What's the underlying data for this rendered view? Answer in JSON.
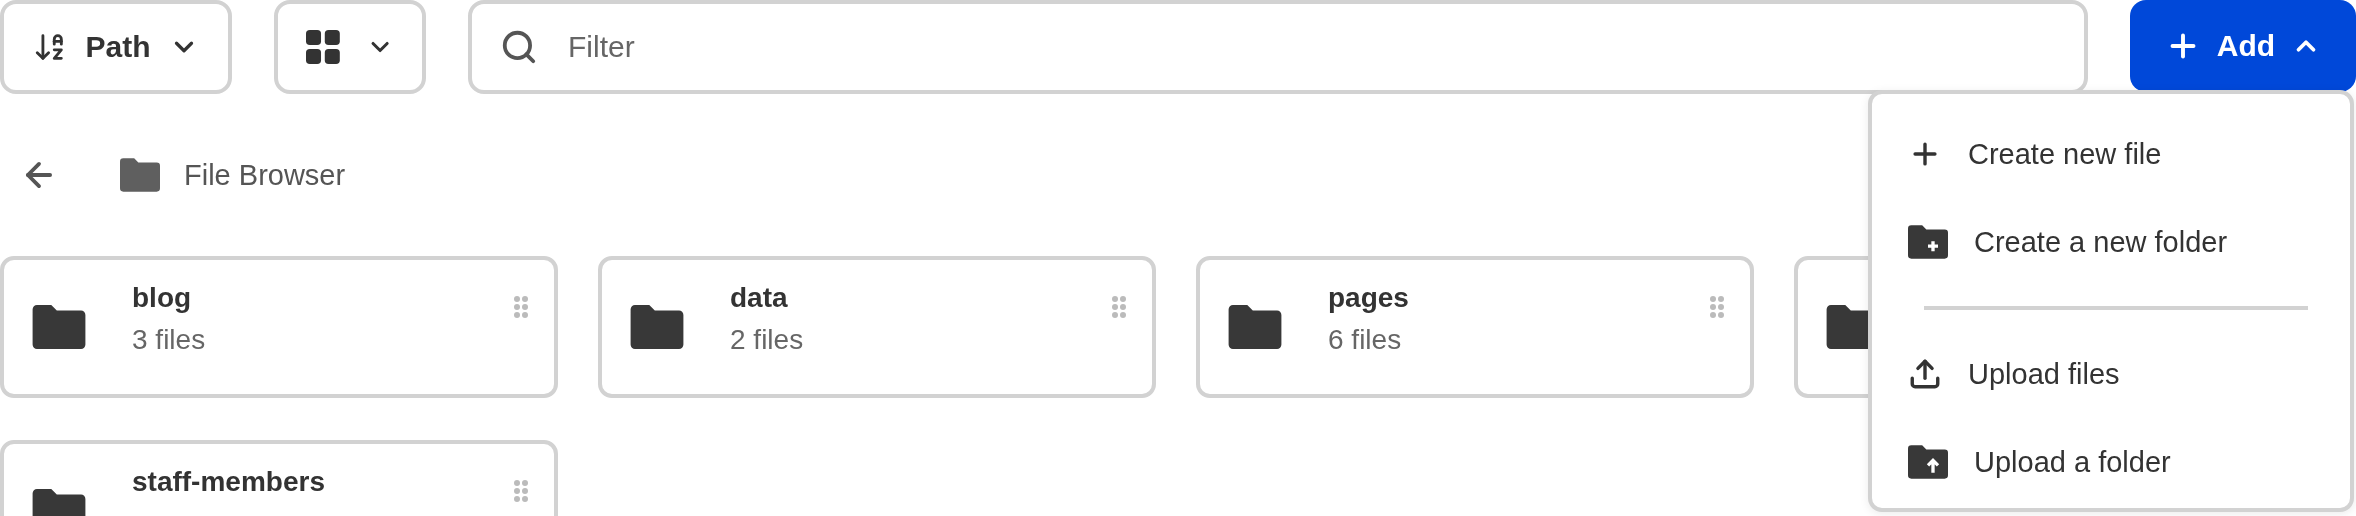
{
  "toolbar": {
    "sort": {
      "label": "Path"
    },
    "filter": {
      "placeholder": "Filter"
    },
    "add_button": {
      "label": "Add",
      "expanded": true
    }
  },
  "breadcrumb": {
    "label": "File Browser"
  },
  "folders": [
    {
      "kind": "folder",
      "name": "blog",
      "count": "3 files"
    },
    {
      "kind": "folder",
      "name": "data",
      "count": "2 files"
    },
    {
      "kind": "folder",
      "name": "pages",
      "count": "6 files"
    },
    {
      "kind": "covered"
    },
    {
      "kind": "folder",
      "name": "staff-members"
    }
  ],
  "add_menu": {
    "groups": [
      [
        {
          "kind": "new-file",
          "label": "Create new file"
        },
        {
          "kind": "new-folder",
          "label": "Create a new folder"
        }
      ],
      [
        {
          "kind": "upload-files",
          "label": "Upload files"
        },
        {
          "kind": "upload-folder",
          "label": "Upload a folder"
        }
      ]
    ]
  }
}
